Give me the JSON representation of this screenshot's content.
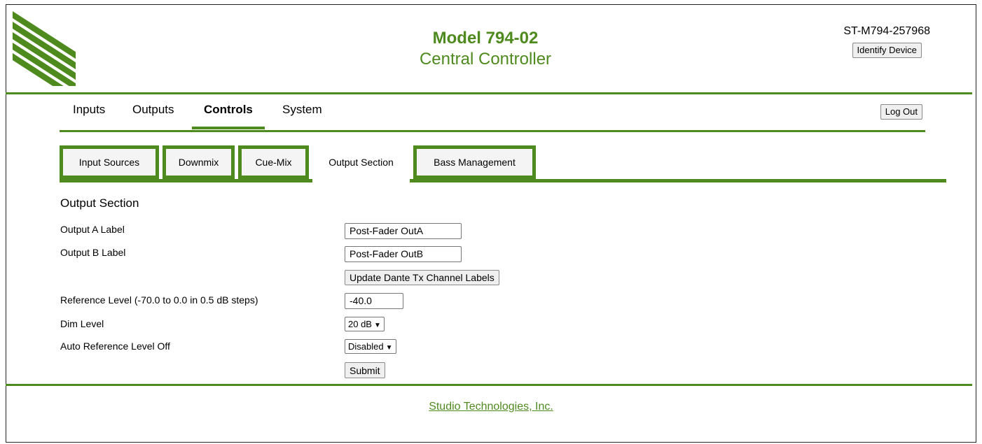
{
  "header": {
    "model": "Model 794-02",
    "subtitle": "Central Controller",
    "device_id": "ST-M794-257968",
    "identify_label": "Identify Device"
  },
  "nav": {
    "items": [
      {
        "label": "Inputs"
      },
      {
        "label": "Outputs"
      },
      {
        "label": "Controls"
      },
      {
        "label": "System"
      }
    ],
    "active": "Controls",
    "logout_label": "Log Out"
  },
  "tabs": {
    "items": [
      {
        "label": "Input Sources"
      },
      {
        "label": "Downmix"
      },
      {
        "label": "Cue-Mix"
      },
      {
        "label": "Output Section"
      },
      {
        "label": "Bass Management"
      }
    ],
    "active": "Output Section"
  },
  "form": {
    "section_title": "Output Section",
    "output_a_label": "Output A Label",
    "output_a_value": "Post-Fader OutA",
    "output_b_label": "Output B Label",
    "output_b_value": "Post-Fader OutB",
    "update_labels_button": "Update Dante Tx Channel Labels",
    "ref_level_label": "Reference Level (-70.0 to 0.0 in 0.5 dB steps)",
    "ref_level_value": "-40.0",
    "dim_level_label": "Dim Level",
    "dim_level_value": "20 dB",
    "auto_ref_label": "Auto Reference Level Off",
    "auto_ref_value": "Disabled",
    "submit_label": "Submit"
  },
  "footer": {
    "company": "Studio Technologies, Inc."
  },
  "colors": {
    "accent": "#4f8a1f"
  }
}
